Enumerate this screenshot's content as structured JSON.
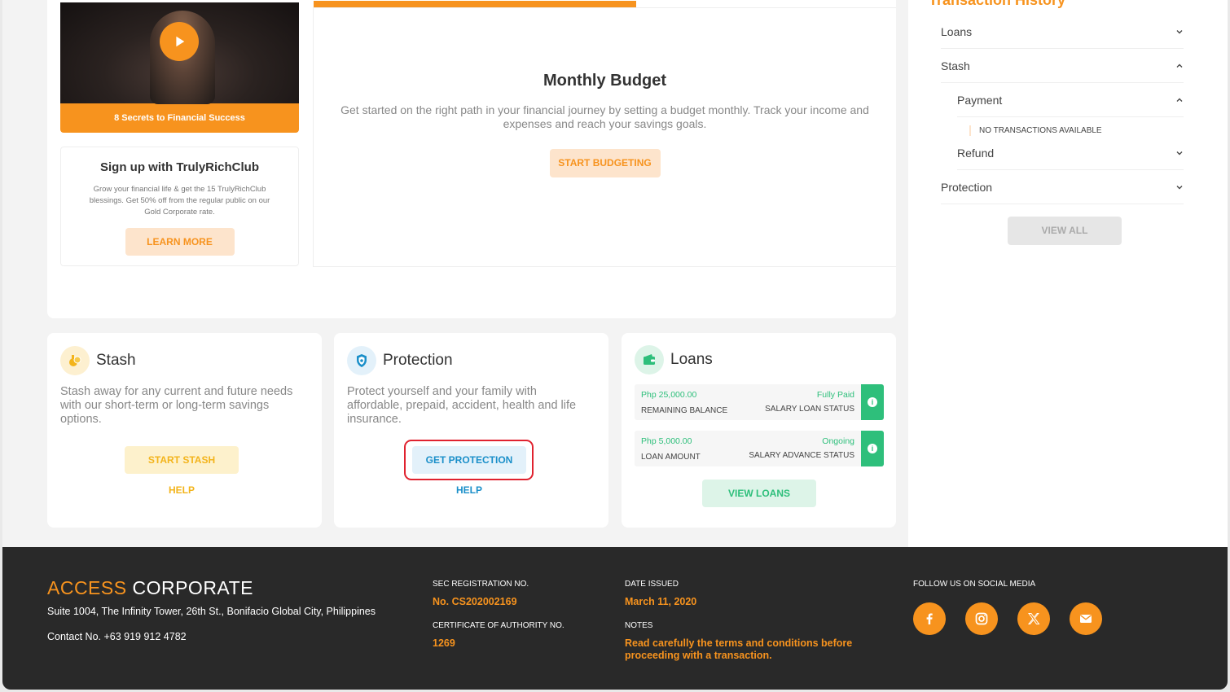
{
  "video": {
    "caption": "8 Secrets to Financial Success"
  },
  "signup": {
    "title": "Sign up with TrulyRichClub",
    "description": "Grow your financial life & get the 15 TrulyRichClub blessings. Get 50% off from the regular public on our Gold Corporate rate.",
    "button": "LEARN MORE"
  },
  "budget": {
    "title": "Monthly Budget",
    "description": "Get started on the right path in your financial journey by setting a budget monthly.  Track your income and expenses and reach your savings goals.",
    "button": "START BUDGETING"
  },
  "sidebar": {
    "title": "Transaction History",
    "items": [
      {
        "label": "Loans"
      },
      {
        "label": "Stash"
      },
      {
        "label": "Payment"
      },
      {
        "label": "Refund"
      },
      {
        "label": "Protection"
      }
    ],
    "empty": "NO TRANSACTIONS AVAILABLE",
    "view_all": "VIEW ALL"
  },
  "stash": {
    "title": "Stash",
    "description": "Stash away for any current and future needs with our short-term or long-term savings options.",
    "button": "START STASH",
    "help": "HELP"
  },
  "protection": {
    "title": "Protection",
    "description": "Protect yourself and your family with affordable, prepaid, accident, health and life insurance.",
    "button": "GET PROTECTION",
    "help": "HELP"
  },
  "loans": {
    "title": "Loans",
    "rows": [
      {
        "amount": "Php 25,000.00",
        "amount_label": "REMAINING BALANCE",
        "status": "Fully Paid",
        "status_label": "SALARY LOAN STATUS"
      },
      {
        "amount": "Php 5,000.00",
        "amount_label": "LOAN AMOUNT",
        "status": "Ongoing",
        "status_label": "SALARY ADVANCE STATUS"
      }
    ],
    "button": "VIEW LOANS"
  },
  "footer": {
    "logo_access": "ACCESS",
    "logo_corporate": "CORPORATE",
    "address": "Suite 1004, The Infinity Tower, 26th St., Bonifacio Global City, Philippines",
    "contact": "Contact No. +63 919 912 4782",
    "sec_label": "SEC REGISTRATION NO.",
    "sec_value": "No. CS202002169",
    "coa_label": "CERTIFICATE OF AUTHORITY NO.",
    "coa_value": "1269",
    "date_label": "DATE ISSUED",
    "date_value": "March 11, 2020",
    "notes_label": "NOTES",
    "notes_value": "Read carefully the terms and conditions before proceeding with a transaction.",
    "social_label": "FOLLOW US ON SOCIAL MEDIA",
    "social_icons": [
      "facebook-icon",
      "instagram-icon",
      "x-icon",
      "email-icon"
    ]
  },
  "colors": {
    "accent": "#f7931e",
    "green": "#2ebf7b",
    "blue": "#1a8fc9",
    "yellow": "#f3b41b",
    "footer_bg": "#292929"
  }
}
